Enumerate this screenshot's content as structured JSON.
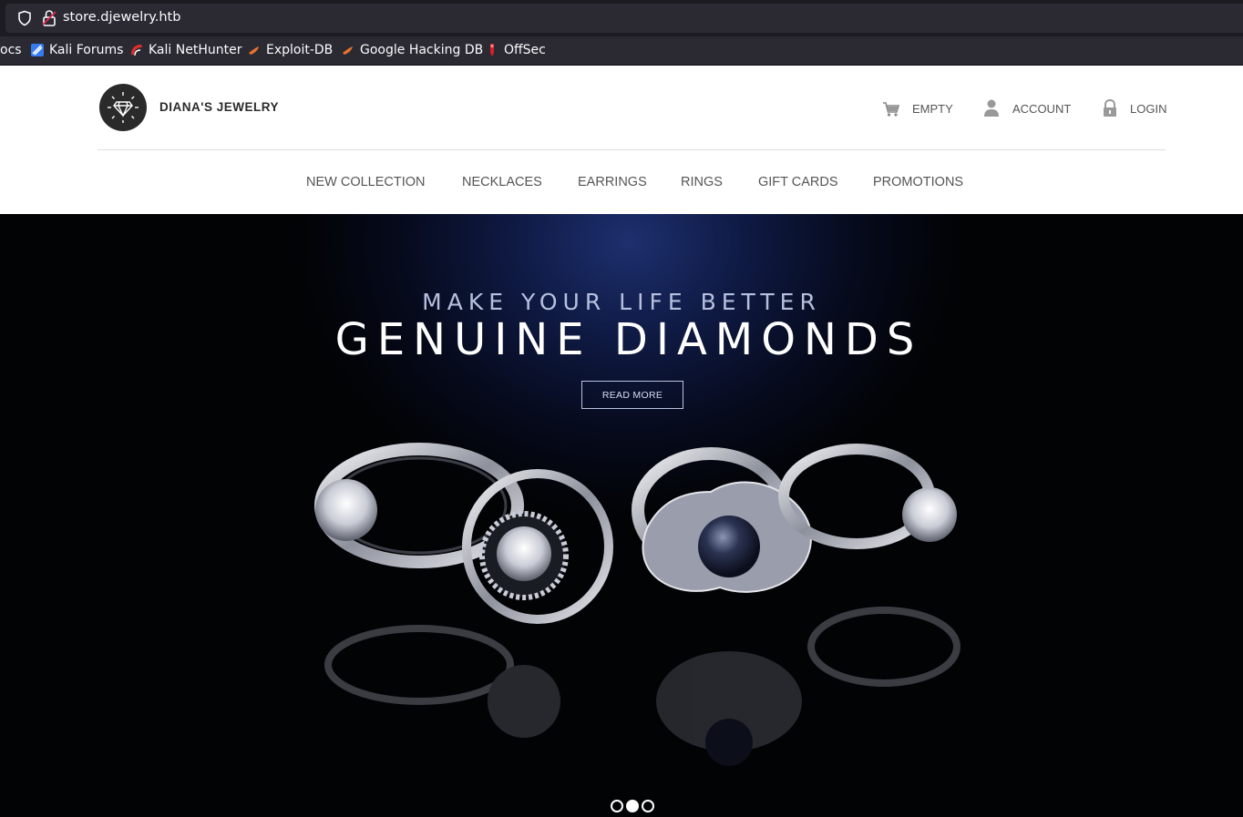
{
  "browser": {
    "url": "store.djewelry.htb",
    "bookmarks": [
      {
        "label": "ocs",
        "icon": "none"
      },
      {
        "label": "Kali Forums",
        "icon": "kali-forums-icon"
      },
      {
        "label": "Kali NetHunter",
        "icon": "kali-nethunter-icon"
      },
      {
        "label": "Exploit-DB",
        "icon": "exploit-db-icon"
      },
      {
        "label": "Google Hacking DB",
        "icon": "ghdb-icon"
      },
      {
        "label": "OffSec",
        "icon": "offsec-icon"
      }
    ]
  },
  "header": {
    "brand": "DIANA'S JEWELRY",
    "cart_label": "EMPTY",
    "account_label": "ACCOUNT",
    "login_label": "LOGIN"
  },
  "nav": {
    "items": [
      "NEW COLLECTION",
      "NECKLACES",
      "EARRINGS",
      "RINGS",
      "GIFT CARDS",
      "PROMOTIONS"
    ]
  },
  "hero": {
    "subtitle": "MAKE YOUR LIFE BETTER",
    "title": "GENUINE DIAMONDS",
    "button_label": "READ MORE",
    "slides_total": 3,
    "active_slide": 2
  },
  "colors": {
    "browser_bg": "#1c1b22",
    "urlfield_bg": "#2b2a33",
    "hero_glow": "#1d2f6e",
    "brand_dark": "#2a2a2a",
    "nav_text": "#555555"
  }
}
